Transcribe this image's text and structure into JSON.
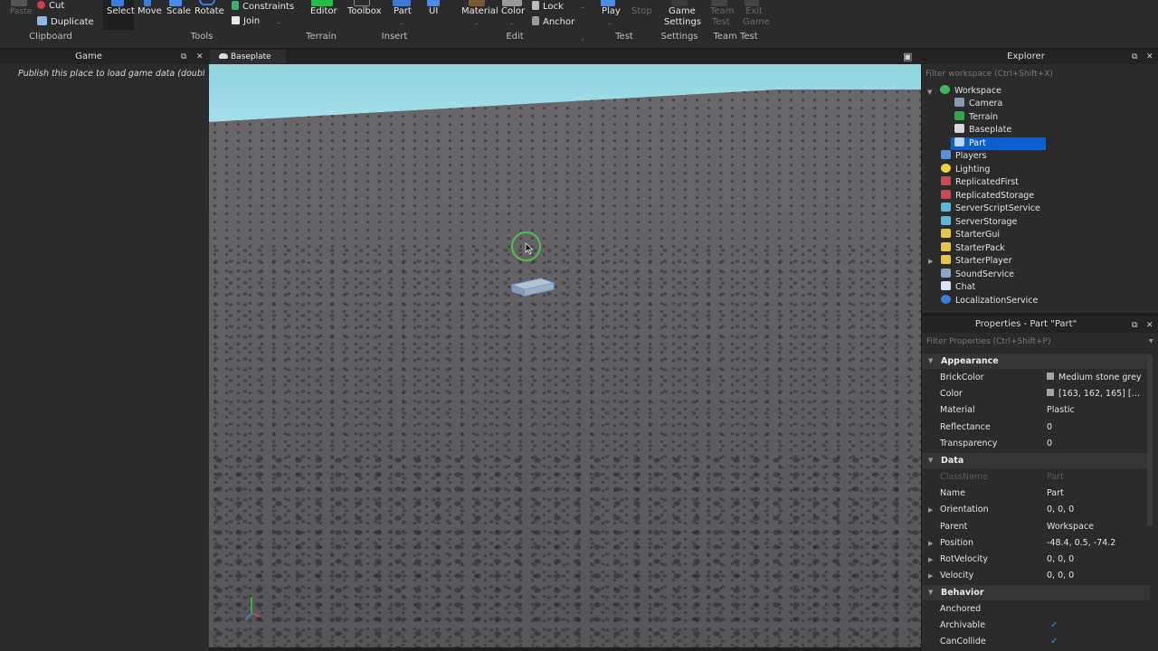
{
  "ribbon": {
    "clipboard": {
      "paste": "Paste",
      "cut": "Cut",
      "duplicate": "Duplicate",
      "group": "Clipboard"
    },
    "tools": {
      "select": "Select",
      "move": "Move",
      "scale": "Scale",
      "rotate": "Rotate",
      "constraints": "Constraints",
      "join": "Join",
      "group": "Tools"
    },
    "terrain": {
      "editor": "Editor",
      "group": "Terrain"
    },
    "insert": {
      "toolbox": "Toolbox",
      "part": "Part",
      "ui": "UI",
      "group": "Insert"
    },
    "edit": {
      "material": "Material",
      "color": "Color",
      "lock": "Lock",
      "anchor": "Anchor",
      "group": "Edit"
    },
    "test": {
      "play": "Play",
      "stop": "Stop",
      "group": "Test"
    },
    "settings": {
      "game_settings_1": "Game",
      "game_settings_2": "Settings",
      "group": "Settings"
    },
    "team_test": {
      "team_test_1": "Team",
      "team_test_2": "Test",
      "exit_game_1": "Exit",
      "exit_game_2": "Game",
      "group": "Team Test"
    }
  },
  "tabs": {
    "game_panel": "Game",
    "viewport_tab": "Baseplate",
    "explorer_panel": "Explorer"
  },
  "game_panel": {
    "message": "Publish this place to load game data (double cli..."
  },
  "explorer": {
    "filter_placeholder": "Filter workspace (Ctrl+Shift+X)",
    "items": [
      {
        "label": "Workspace",
        "icon": "globe-icon"
      },
      {
        "label": "Camera",
        "icon": "camera-icon"
      },
      {
        "label": "Terrain",
        "icon": "terrain-icon"
      },
      {
        "label": "Baseplate",
        "icon": "part-icon"
      },
      {
        "label": "Part",
        "icon": "part-icon"
      },
      {
        "label": "Players",
        "icon": "players-icon"
      },
      {
        "label": "Lighting",
        "icon": "lightbulb-icon"
      },
      {
        "label": "ReplicatedFirst",
        "icon": "replicated-icon"
      },
      {
        "label": "ReplicatedStorage",
        "icon": "replicated-icon"
      },
      {
        "label": "ServerScriptService",
        "icon": "server-icon"
      },
      {
        "label": "ServerStorage",
        "icon": "server-icon"
      },
      {
        "label": "StarterGui",
        "icon": "folder-icon"
      },
      {
        "label": "StarterPack",
        "icon": "folder-icon"
      },
      {
        "label": "StarterPlayer",
        "icon": "folder-icon"
      },
      {
        "label": "SoundService",
        "icon": "sound-icon"
      },
      {
        "label": "Chat",
        "icon": "chat-icon"
      },
      {
        "label": "LocalizationService",
        "icon": "globe-icon"
      }
    ]
  },
  "properties": {
    "title": "Properties - Part \"Part\"",
    "filter_placeholder": "Filter Properties (Ctrl+Shift+P)",
    "sections": {
      "appearance": "Appearance",
      "data": "Data",
      "behavior": "Behavior"
    },
    "appearance_rows": [
      {
        "name": "BrickColor",
        "value": "Medium stone grey"
      },
      {
        "name": "Color",
        "value": "[163, 162, 165] [Med..."
      },
      {
        "name": "Material",
        "value": "Plastic"
      },
      {
        "name": "Reflectance",
        "value": "0"
      },
      {
        "name": "Transparency",
        "value": "0"
      }
    ],
    "data_rows": [
      {
        "name": "ClassName",
        "value": "Part"
      },
      {
        "name": "Name",
        "value": "Part"
      },
      {
        "name": "Orientation",
        "value": "0, 0, 0"
      },
      {
        "name": "Parent",
        "value": "Workspace"
      },
      {
        "name": "Position",
        "value": "-48.4, 0.5, -74.2"
      },
      {
        "name": "RotVelocity",
        "value": "0, 0, 0"
      },
      {
        "name": "Velocity",
        "value": "0, 0, 0"
      }
    ],
    "behavior_rows": [
      {
        "name": "Anchored",
        "value": ""
      },
      {
        "name": "Archivable",
        "value": "✓"
      },
      {
        "name": "CanCollide",
        "value": "✓"
      }
    ]
  },
  "colors": {
    "selection": "#0b5fd1",
    "panel": "#2b2b2b",
    "sky": "#a6e0ea",
    "baseplate": "#615f62",
    "cursor_ring": "#4ac44a"
  }
}
